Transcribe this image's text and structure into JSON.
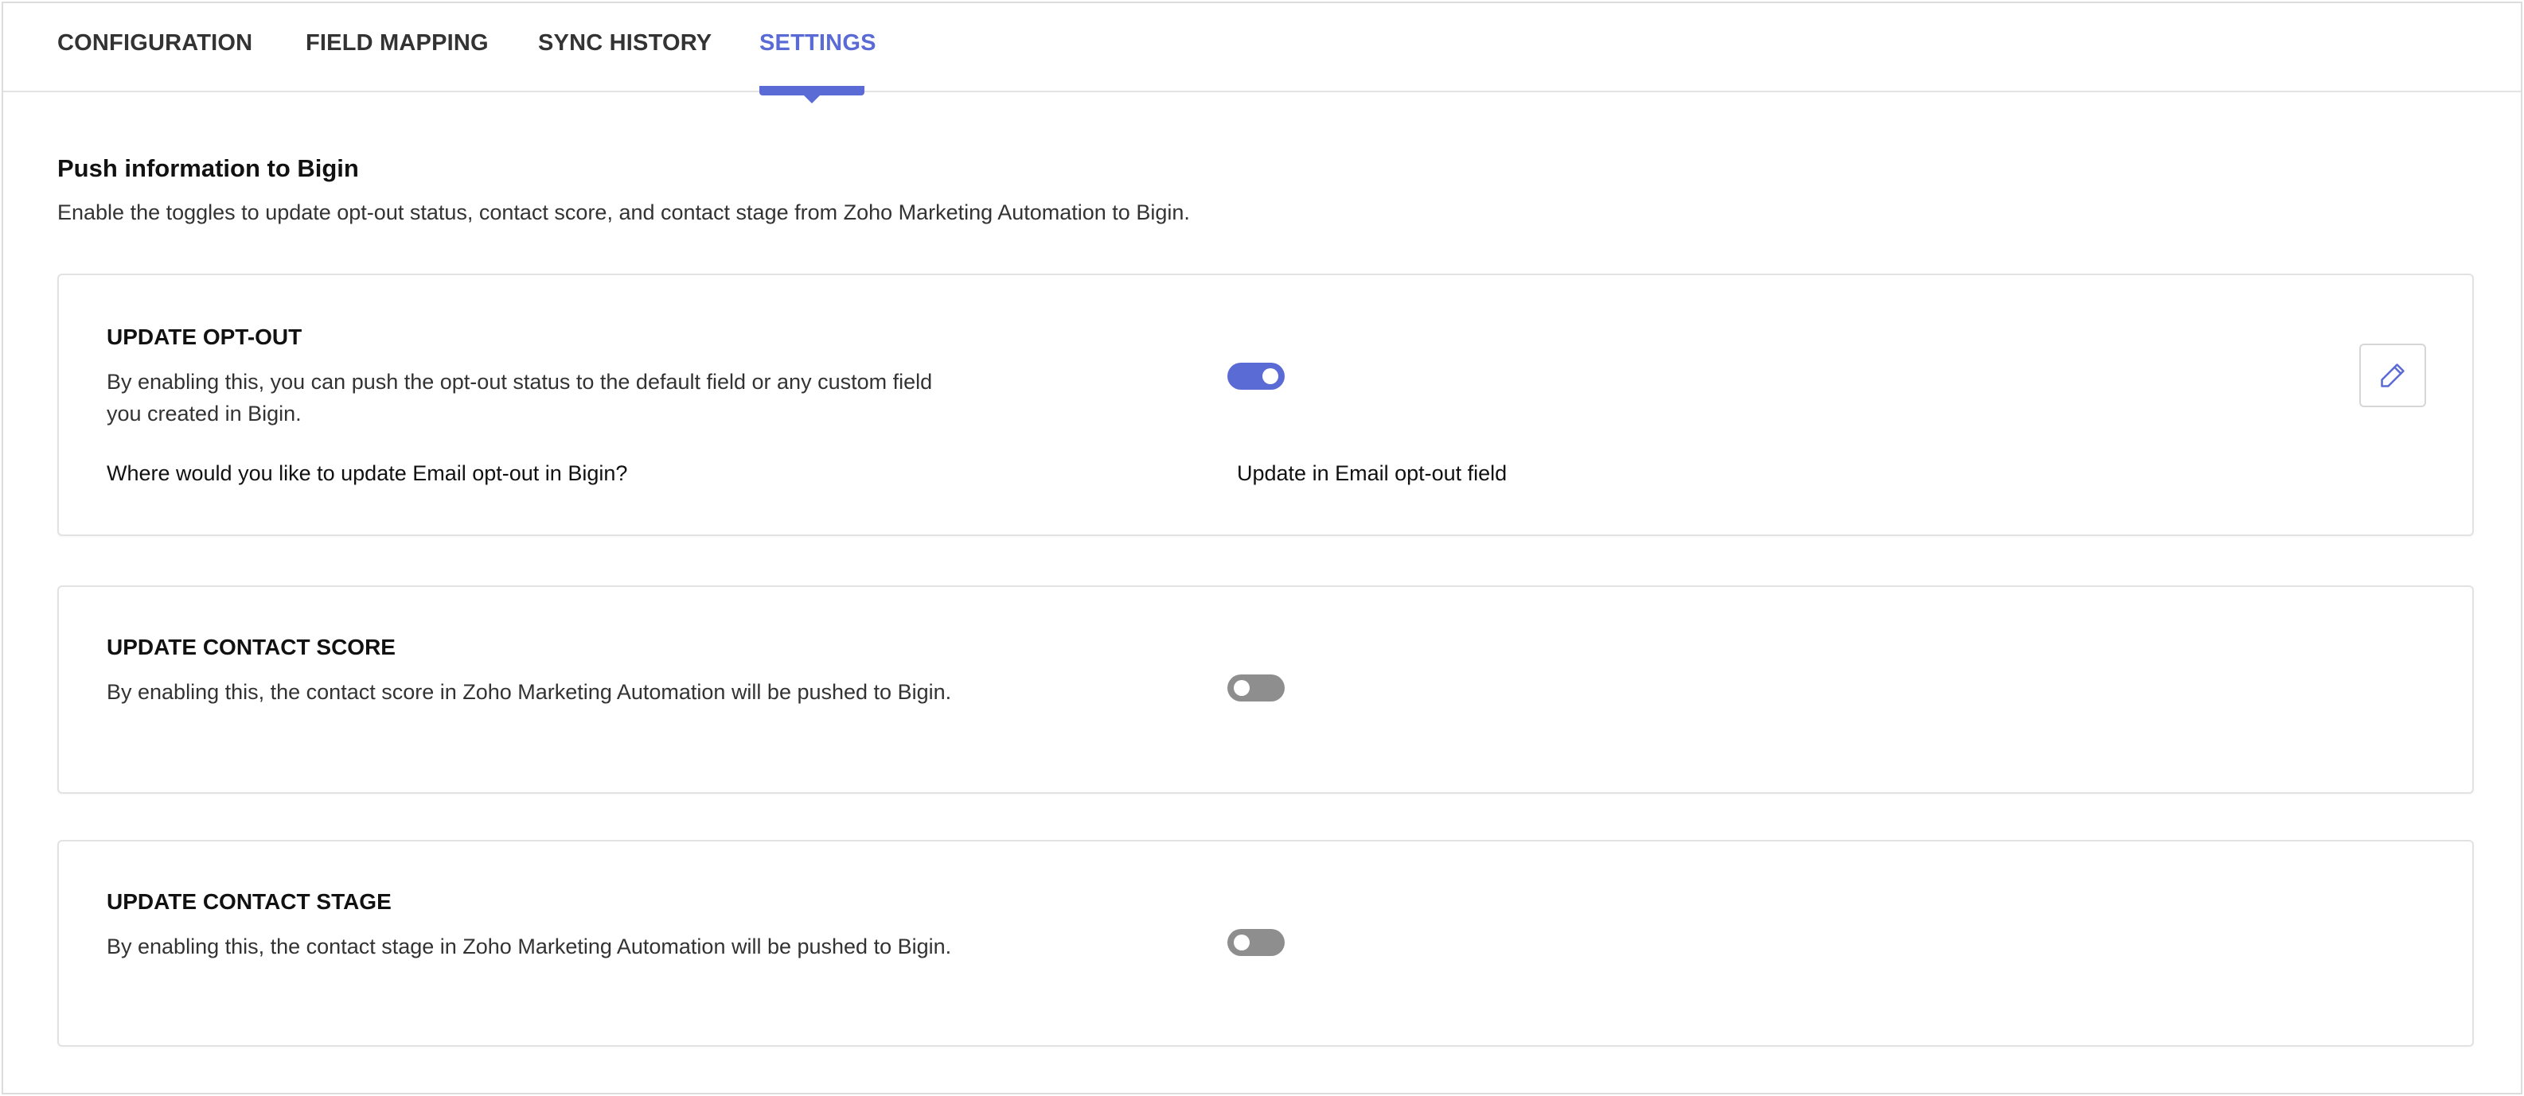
{
  "tabs": [
    {
      "label": "CONFIGURATION",
      "active": false
    },
    {
      "label": "FIELD MAPPING",
      "active": false
    },
    {
      "label": "SYNC HISTORY",
      "active": false
    },
    {
      "label": "SETTINGS",
      "active": true
    }
  ],
  "section": {
    "title": "Push information to Bigin",
    "description": "Enable the toggles to update opt-out status, contact score, and contact stage from Zoho Marketing Automation to Bigin."
  },
  "cards": [
    {
      "title": "UPDATE OPT-OUT",
      "description": "By enabling this, you can push the opt-out status to the default field or any custom field you created in Bigin.",
      "toggle_on": true,
      "question": "Where would you like to update Email opt-out in Bigin?",
      "answer": "Update in Email opt-out field",
      "edit_icon": "pencil-icon"
    },
    {
      "title": "UPDATE CONTACT SCORE",
      "description": "By enabling this, the contact score in Zoho Marketing Automation will be pushed to Bigin.",
      "toggle_on": false
    },
    {
      "title": "UPDATE CONTACT STAGE",
      "description": "By enabling this, the contact stage in Zoho Marketing Automation will be pushed to Bigin.",
      "toggle_on": false
    }
  ],
  "colors": {
    "accent": "#5b6bd5",
    "toggle_off": "#8e8e8e",
    "border": "#e2e2e2"
  }
}
